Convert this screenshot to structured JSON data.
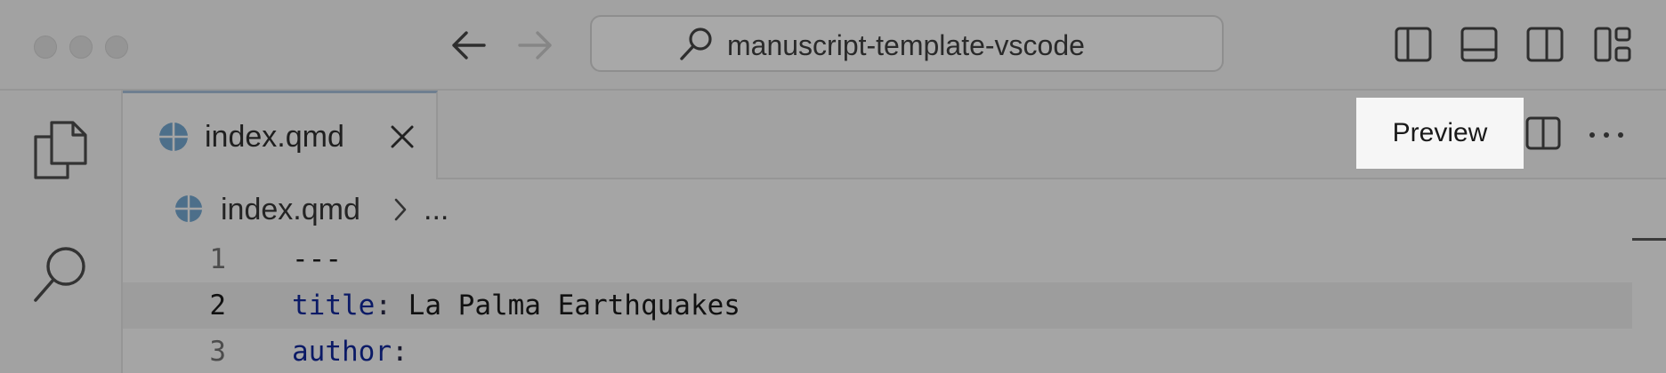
{
  "titlebar": {
    "search_text": "manuscript-template-vscode"
  },
  "tabs": [
    {
      "label": "index.qmd",
      "icon": "quarto-file-icon",
      "active": true
    }
  ],
  "toolbar": {
    "preview_label": "Preview"
  },
  "breadcrumb": {
    "file": "index.qmd",
    "rest": "..."
  },
  "editor": {
    "lines": [
      {
        "number": "1",
        "text": "---"
      },
      {
        "number": "2",
        "key": "title",
        "colon": ":",
        "value": " La Palma Earthquakes"
      },
      {
        "number": "3",
        "key": "author",
        "colon": ":",
        "value": ""
      }
    ]
  },
  "colors": {
    "accent": "#4d6f8a",
    "overlay": "#a5a5a5",
    "yaml_key": "#0b1a66"
  }
}
